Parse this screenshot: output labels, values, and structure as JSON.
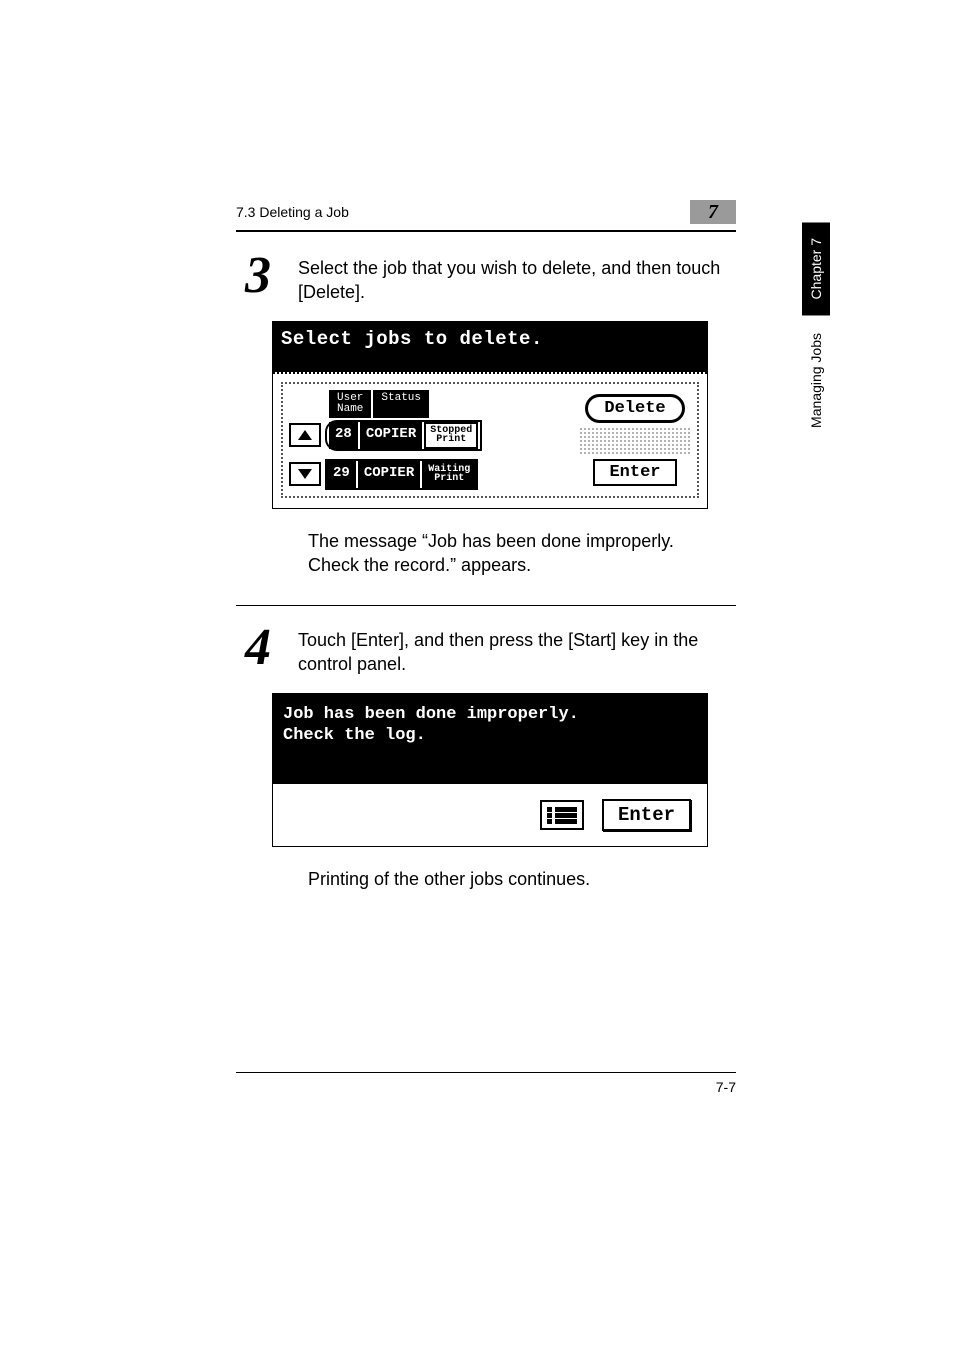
{
  "header": {
    "section": "7.3 Deleting a Job",
    "chapter_num": "7"
  },
  "sidebar": {
    "chapter_label": "Chapter 7",
    "section_label": "Managing Jobs"
  },
  "steps": {
    "s3": {
      "num": "3",
      "text": "Select the job that you wish to delete, and then touch [Delete]."
    },
    "s4": {
      "num": "4",
      "text": "Touch [Enter], and then press the [Start] key in the control panel."
    }
  },
  "screen1": {
    "title": "Select jobs to delete.",
    "headers": {
      "user": "User\nName",
      "status": "Status"
    },
    "rows": [
      {
        "id": "28",
        "user": "COPIER",
        "status1": "Stopped",
        "status2": "Print",
        "selected": true
      },
      {
        "id": "29",
        "user": "COPIER",
        "status1": "Waiting",
        "status2": "Print",
        "selected": false
      }
    ],
    "delete_btn": "Delete",
    "enter_btn": "Enter"
  },
  "message_after_s3": "The message “Job has been done improperly. Check the record.” appears.",
  "screen2": {
    "line1": "Job has been done improperly.",
    "line2": "Check the log.",
    "enter_btn": "Enter"
  },
  "message_after_s4": "Printing of the other jobs continues.",
  "footer": {
    "page": "7-7"
  }
}
